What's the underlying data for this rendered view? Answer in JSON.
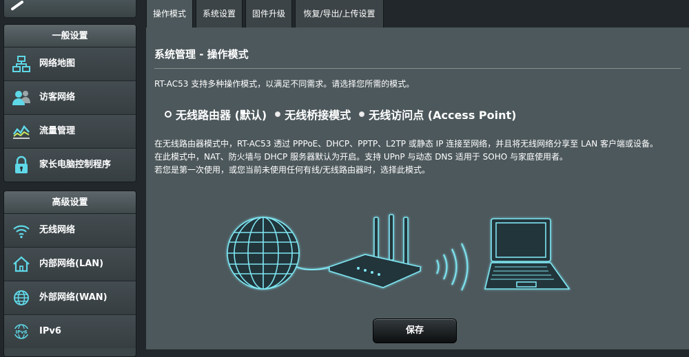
{
  "sidebar": {
    "general": {
      "title": "一般设置",
      "items": [
        {
          "label": "网络地图",
          "icon": "network-map-icon"
        },
        {
          "label": "访客网络",
          "icon": "guest-network-icon"
        },
        {
          "label": "流量管理",
          "icon": "traffic-manager-icon"
        },
        {
          "label": "家长电脑控制程序",
          "icon": "parental-control-icon"
        }
      ]
    },
    "advanced": {
      "title": "高级设置",
      "items": [
        {
          "label": "无线网络",
          "icon": "wireless-icon"
        },
        {
          "label": "内部网络(LAN)",
          "icon": "lan-home-icon"
        },
        {
          "label": "外部网络(WAN)",
          "icon": "wan-globe-icon"
        },
        {
          "label": "IPv6",
          "icon": "ipv6-globe-icon"
        }
      ]
    }
  },
  "tabs": [
    {
      "label": "操作模式",
      "active": true
    },
    {
      "label": "系统设置",
      "active": false
    },
    {
      "label": "固件升级",
      "active": false
    },
    {
      "label": "恢复/导出/上传设置",
      "active": false
    }
  ],
  "main": {
    "title": "系统管理 - 操作模式",
    "intro": "RT-AC53 支持多种操作模式，以满足不同需求。请选择您所需的模式。",
    "modes": [
      {
        "label": "无线路由器 (默认)",
        "checked": true
      },
      {
        "label": "无线桥接模式",
        "checked": false
      },
      {
        "label": "无线访问点 (Access Point)",
        "checked": false
      }
    ],
    "description": [
      "在无线路由器模式中，RT-AC53 透过 PPPoE、DHCP、PPTP、L2TP 或静态 IP 连接至网络，并且将无线网络分享至 LAN 客户端或设备。",
      "在此模式中，NAT、防火墙与 DHCP 服务器默认为开启。支持 UPnP 与动态 DNS 适用于 SOHO 与家庭使用者。",
      "若您是第一次使用，或您当前未使用任何有线/无线路由器时，选择此模式。"
    ],
    "save_label": "保存"
  },
  "colors": {
    "panel_bg": "#4d585c",
    "page_bg": "#21272b",
    "accent_cyan": "#5fd8e8"
  }
}
